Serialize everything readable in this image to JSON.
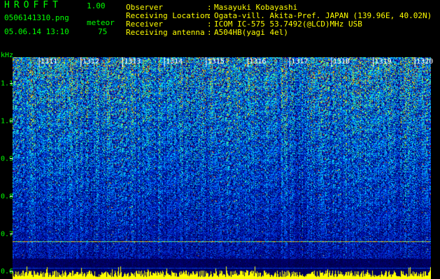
{
  "header": {
    "app_title": "HROFFT",
    "app_version": "1.00",
    "file_name": "0506141310.png",
    "meteor_label": "meteor",
    "date_time": "05.06.14 13:10",
    "meteor_count": "75"
  },
  "station": {
    "rows": [
      {
        "key": "Observer",
        "value": "Masayuki Kobayashi"
      },
      {
        "key": "Receiving Location",
        "value": "Ogata-vill. Akita-Pref. JAPAN (139.96E, 40.02N)"
      },
      {
        "key": "Receiver",
        "value": "ICOM IC-575 53.7492(@LCD)MHz USB"
      },
      {
        "key": "Receiving antenna",
        "value": "A504HB(yagi 4el)"
      }
    ],
    "colon": ":"
  },
  "chart_data": {
    "type": "heatmap",
    "ylabel": "kHz",
    "y_ticks": [
      "1.1",
      "1.0",
      "0.9",
      "0.8",
      "0.7",
      "0.6"
    ],
    "ylim": [
      0.58,
      1.17
    ],
    "x_ticks": [
      "1311",
      "1312",
      "1313",
      "1314",
      "1315",
      "1316",
      "1317",
      "1318",
      "1319",
      "1320"
    ],
    "notable_lines_khz": [
      0.68,
      0.61
    ],
    "colors": {
      "background": "#000044",
      "low": "#0000aa",
      "mid": "#00aaff",
      "high": "#00ff88",
      "peak": "#ffff00",
      "hot": "#ff3300"
    }
  }
}
